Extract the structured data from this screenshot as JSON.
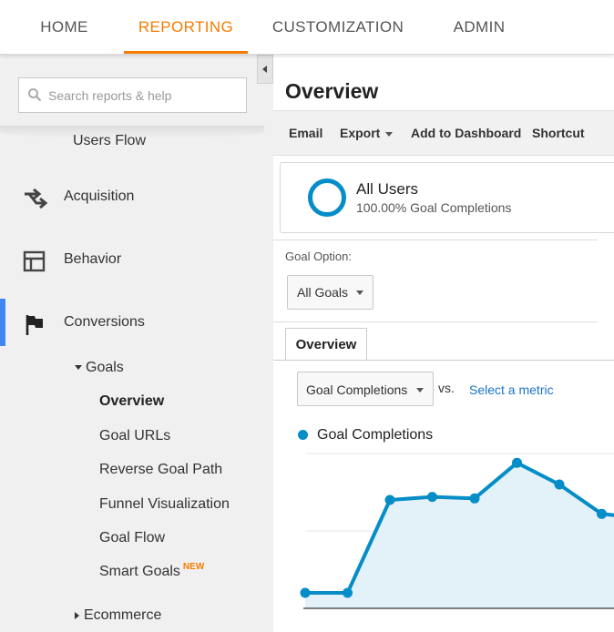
{
  "topnav": {
    "tabs": [
      {
        "label": "HOME"
      },
      {
        "label": "REPORTING"
      },
      {
        "label": "CUSTOMIZATION"
      },
      {
        "label": "ADMIN"
      }
    ],
    "active": "REPORTING"
  },
  "sidebar": {
    "search_placeholder": "Search reports & help",
    "users_flow": "Users Flow",
    "items": [
      {
        "label": "Acquisition",
        "icon": "acquisition-arrows-icon"
      },
      {
        "label": "Behavior",
        "icon": "behavior-layout-icon"
      },
      {
        "label": "Conversions",
        "icon": "flag-icon"
      }
    ],
    "goals_label": "Goals",
    "goals_subitems": [
      {
        "label": "Overview"
      },
      {
        "label": "Goal URLs"
      },
      {
        "label": "Reverse Goal Path"
      },
      {
        "label": "Funnel Visualization"
      },
      {
        "label": "Goal Flow"
      },
      {
        "label": "Smart Goals"
      }
    ],
    "new_badge": "NEW",
    "ecommerce_label": "Ecommerce"
  },
  "main": {
    "title": "Overview",
    "toolbar": {
      "email": "Email",
      "export": "Export",
      "add_to_dashboard": "Add to Dashboard",
      "shortcut": "Shortcut"
    },
    "segment": {
      "name": "All Users",
      "sub": "100.00% Goal Completions"
    },
    "goal_option_label": "Goal Option:",
    "goal_option_value": "All Goals",
    "tab_label": "Overview",
    "metric_value": "Goal Completions",
    "vs_label": "vs.",
    "select_metric": "Select a metric",
    "legend_label": "Goal Completions"
  },
  "colors": {
    "accent": "#f57c00",
    "series": "#058dc7",
    "fill": "#e3f1f9",
    "active_bar": "#4285f4"
  },
  "chart_data": {
    "type": "area",
    "series": [
      {
        "name": "Goal Completions",
        "values": [
          1,
          1,
          7,
          7.2,
          7.1,
          9.4,
          8,
          6.1,
          5.8
        ]
      }
    ],
    "ylim": [
      0,
      10
    ],
    "grid": true
  }
}
